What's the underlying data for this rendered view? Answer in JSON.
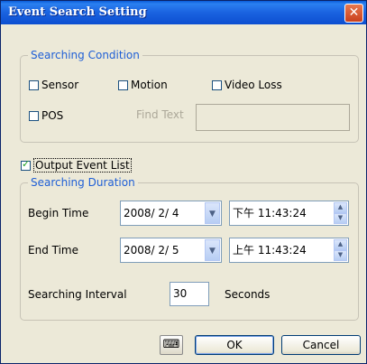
{
  "window": {
    "title": "Event Search Setting",
    "close_symbol": "✕"
  },
  "searching_condition": {
    "title": "Searching Condition",
    "sensor": {
      "label": "Sensor",
      "checked": false
    },
    "motion": {
      "label": "Motion",
      "checked": false
    },
    "video_loss": {
      "label": "Video Loss",
      "checked": false
    },
    "pos": {
      "label": "POS",
      "checked": false
    },
    "find_text": {
      "label": "Find Text",
      "value": ""
    }
  },
  "output_event_list": {
    "label": "Output Event List",
    "checked": true
  },
  "searching_duration": {
    "title": "Searching Duration",
    "begin_time": {
      "label": "Begin Time",
      "date": "2008/ 2/ 4",
      "time": "下午 11:43:24"
    },
    "end_time": {
      "label": "End Time",
      "date": "2008/ 2/ 5",
      "time": "上午 11:43:24"
    },
    "interval": {
      "label": "Searching Interval",
      "value": "30",
      "unit": "Seconds"
    }
  },
  "buttons": {
    "keyboard_icon": "keyboard-icon",
    "ok": "OK",
    "cancel": "Cancel"
  },
  "icons": {
    "combo_arrow": "▼",
    "spin_up": "▲",
    "spin_down": "▼",
    "keyboard_glyph": "⌨"
  }
}
